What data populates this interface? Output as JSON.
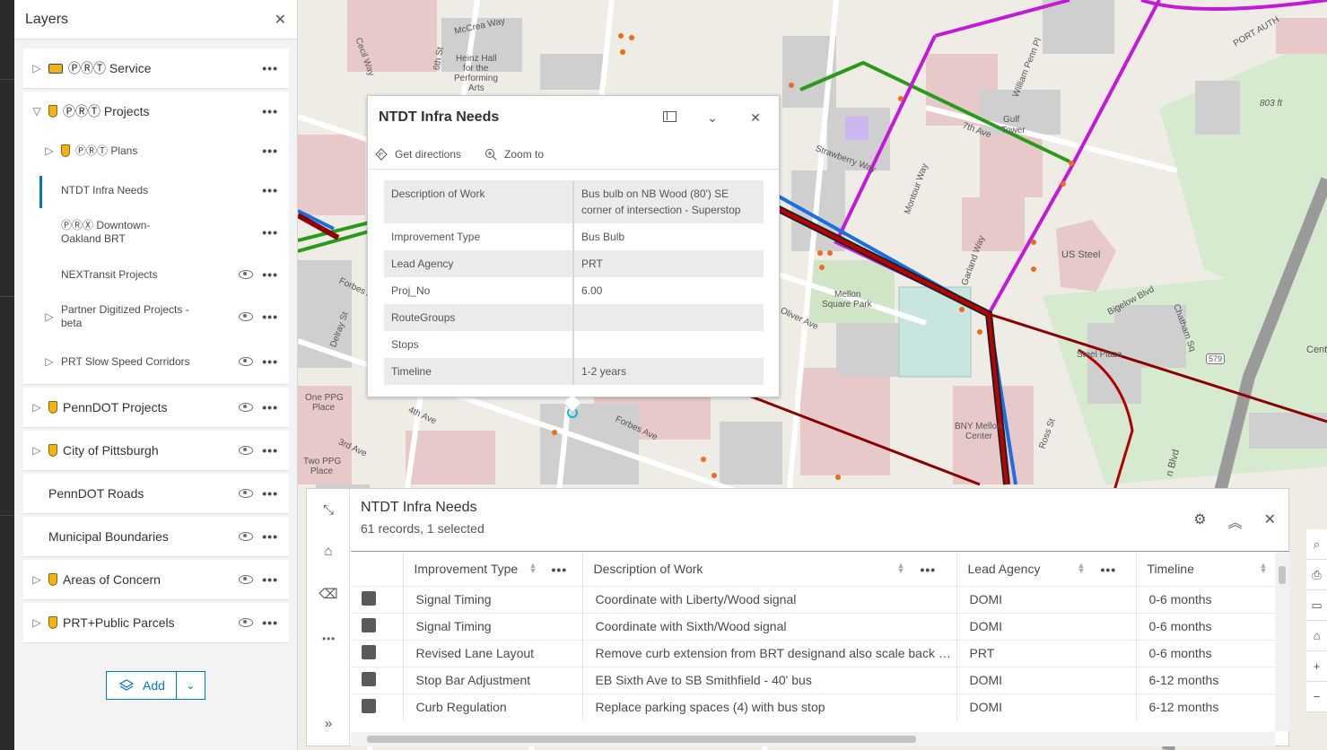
{
  "layers_panel": {
    "title": "Layers",
    "close_icon": "close-icon",
    "items": [
      {
        "label": "ⓅⓇⓉ Service",
        "expanded": false,
        "icon": "bus-icon"
      },
      {
        "label": "ⓅⓇⓉ Projects",
        "expanded": true,
        "icon": "pin-icon"
      },
      {
        "label": "ⓅⓇⓉ Plans",
        "icon": "pin-icon"
      },
      {
        "label": "NTDT Infra Needs",
        "selected": true
      },
      {
        "label": "ⓅⓇⓍ Downtown-",
        "label2": "Oakland BRT"
      },
      {
        "label": "NEXTransit Projects"
      },
      {
        "label": "Partner Digitized Projects -",
        "label2": "beta"
      },
      {
        "label": "PRT Slow Speed Corridors"
      },
      {
        "label": "PennDOT Projects",
        "icon": "pin-icon"
      },
      {
        "label": "City of Pittsburgh",
        "icon": "pin-icon"
      },
      {
        "label": "PennDOT Roads"
      },
      {
        "label": "Municipal Boundaries"
      },
      {
        "label": "Areas of Concern",
        "icon": "pin-icon"
      },
      {
        "label": "PRT+Public Parcels",
        "icon": "pin-icon"
      }
    ],
    "add_label": "Add"
  },
  "map_labels": {
    "mccrea": "McCrea Way",
    "heinz": "Heinz Hall",
    "heinz2": "for the",
    "heinz3": "Performing",
    "heinz4": "Arts",
    "sixth": "6th St",
    "cecil": "Cecil Way",
    "strawberry": "Strawberry Way",
    "seventh": "7th Ave",
    "gulf": "Gulf",
    "gulf2": "Tower",
    "penn": "William Penn Pl",
    "elev803": "803 ft",
    "portauth": "PORT AUTH",
    "montour": "Montour Way",
    "garland": "Garland Way",
    "ussteel": "US Steel",
    "bigelow": "Bigelow Blvd",
    "chatham": "Chatham Sq",
    "mellon": "Mellon",
    "mellon2": "Square Park",
    "oliver": "Oliver Ave",
    "stplaza": "Steel Plaza",
    "bnym": "BNY Mellon",
    "bnym2": "Center",
    "forbes": "Forbes Ave",
    "forbes2": "Forbes Ave",
    "fourth": "4th Ave",
    "third": "3rd Ave",
    "oneppg": "One PPG",
    "oneppg2": "Place",
    "twoppg": "Two PPG",
    "twoppg2": "Place",
    "ross": "Ross St",
    "delray": "Delray St",
    "route579": "579",
    "cent": "Cent",
    "blvd": "n Blvd"
  },
  "popup": {
    "title": "NTDT Infra Needs",
    "get_directions": "Get directions",
    "zoom_to": "Zoom to",
    "attributes": [
      {
        "key": "Description of Work",
        "value": "Bus bulb on NB Wood (80') SE corner of intersection - Superstop"
      },
      {
        "key": "Improvement Type",
        "value": "Bus Bulb"
      },
      {
        "key": "Lead Agency",
        "value": "PRT"
      },
      {
        "key": "Proj_No",
        "value": "6.00"
      },
      {
        "key": "RouteGroups",
        "value": ""
      },
      {
        "key": "Stops",
        "value": ""
      },
      {
        "key": "Timeline",
        "value": "1-2 years"
      }
    ]
  },
  "table": {
    "title": "NTDT Infra Needs",
    "subtitle": "61 records, 1 selected",
    "columns": [
      "Improvement Type",
      "Description of Work",
      "Lead Agency",
      "Timeline"
    ],
    "rows": [
      [
        "Signal Timing",
        "Coordinate with Liberty/Wood signal",
        "DOMI",
        "0-6 months"
      ],
      [
        "Signal Timing",
        "Coordinate with Sixth/Wood signal",
        "DOMI",
        "0-6 months"
      ],
      [
        "Revised Lane Layout",
        "Remove curb extension from BRT designand also scale back …",
        "PRT",
        "0-6 months"
      ],
      [
        "Stop Bar Adjustment",
        "EB Sixth Ave to SB Smithfield - 40' bus",
        "DOMI",
        "6-12 months"
      ],
      [
        "Curb Regulation",
        "Replace parking spaces (4) with bus stop",
        "DOMI",
        "6-12 months"
      ]
    ]
  }
}
